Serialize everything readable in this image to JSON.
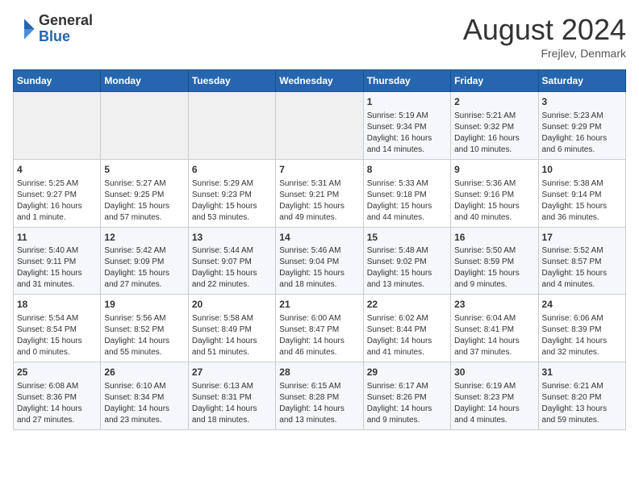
{
  "header": {
    "logo_general": "General",
    "logo_blue": "Blue",
    "month_title": "August 2024",
    "location": "Frejlev, Denmark"
  },
  "weekdays": [
    "Sunday",
    "Monday",
    "Tuesday",
    "Wednesday",
    "Thursday",
    "Friday",
    "Saturday"
  ],
  "weeks": [
    [
      {
        "day": "",
        "empty": true
      },
      {
        "day": "",
        "empty": true
      },
      {
        "day": "",
        "empty": true
      },
      {
        "day": "",
        "empty": true
      },
      {
        "day": "1",
        "line1": "Sunrise: 5:19 AM",
        "line2": "Sunset: 9:34 PM",
        "line3": "Daylight: 16 hours",
        "line4": "and 14 minutes."
      },
      {
        "day": "2",
        "line1": "Sunrise: 5:21 AM",
        "line2": "Sunset: 9:32 PM",
        "line3": "Daylight: 16 hours",
        "line4": "and 10 minutes."
      },
      {
        "day": "3",
        "line1": "Sunrise: 5:23 AM",
        "line2": "Sunset: 9:29 PM",
        "line3": "Daylight: 16 hours",
        "line4": "and 6 minutes."
      }
    ],
    [
      {
        "day": "4",
        "line1": "Sunrise: 5:25 AM",
        "line2": "Sunset: 9:27 PM",
        "line3": "Daylight: 16 hours",
        "line4": "and 1 minute."
      },
      {
        "day": "5",
        "line1": "Sunrise: 5:27 AM",
        "line2": "Sunset: 9:25 PM",
        "line3": "Daylight: 15 hours",
        "line4": "and 57 minutes."
      },
      {
        "day": "6",
        "line1": "Sunrise: 5:29 AM",
        "line2": "Sunset: 9:23 PM",
        "line3": "Daylight: 15 hours",
        "line4": "and 53 minutes."
      },
      {
        "day": "7",
        "line1": "Sunrise: 5:31 AM",
        "line2": "Sunset: 9:21 PM",
        "line3": "Daylight: 15 hours",
        "line4": "and 49 minutes."
      },
      {
        "day": "8",
        "line1": "Sunrise: 5:33 AM",
        "line2": "Sunset: 9:18 PM",
        "line3": "Daylight: 15 hours",
        "line4": "and 44 minutes."
      },
      {
        "day": "9",
        "line1": "Sunrise: 5:36 AM",
        "line2": "Sunset: 9:16 PM",
        "line3": "Daylight: 15 hours",
        "line4": "and 40 minutes."
      },
      {
        "day": "10",
        "line1": "Sunrise: 5:38 AM",
        "line2": "Sunset: 9:14 PM",
        "line3": "Daylight: 15 hours",
        "line4": "and 36 minutes."
      }
    ],
    [
      {
        "day": "11",
        "line1": "Sunrise: 5:40 AM",
        "line2": "Sunset: 9:11 PM",
        "line3": "Daylight: 15 hours",
        "line4": "and 31 minutes."
      },
      {
        "day": "12",
        "line1": "Sunrise: 5:42 AM",
        "line2": "Sunset: 9:09 PM",
        "line3": "Daylight: 15 hours",
        "line4": "and 27 minutes."
      },
      {
        "day": "13",
        "line1": "Sunrise: 5:44 AM",
        "line2": "Sunset: 9:07 PM",
        "line3": "Daylight: 15 hours",
        "line4": "and 22 minutes."
      },
      {
        "day": "14",
        "line1": "Sunrise: 5:46 AM",
        "line2": "Sunset: 9:04 PM",
        "line3": "Daylight: 15 hours",
        "line4": "and 18 minutes."
      },
      {
        "day": "15",
        "line1": "Sunrise: 5:48 AM",
        "line2": "Sunset: 9:02 PM",
        "line3": "Daylight: 15 hours",
        "line4": "and 13 minutes."
      },
      {
        "day": "16",
        "line1": "Sunrise: 5:50 AM",
        "line2": "Sunset: 8:59 PM",
        "line3": "Daylight: 15 hours",
        "line4": "and 9 minutes."
      },
      {
        "day": "17",
        "line1": "Sunrise: 5:52 AM",
        "line2": "Sunset: 8:57 PM",
        "line3": "Daylight: 15 hours",
        "line4": "and 4 minutes."
      }
    ],
    [
      {
        "day": "18",
        "line1": "Sunrise: 5:54 AM",
        "line2": "Sunset: 8:54 PM",
        "line3": "Daylight: 15 hours",
        "line4": "and 0 minutes."
      },
      {
        "day": "19",
        "line1": "Sunrise: 5:56 AM",
        "line2": "Sunset: 8:52 PM",
        "line3": "Daylight: 14 hours",
        "line4": "and 55 minutes."
      },
      {
        "day": "20",
        "line1": "Sunrise: 5:58 AM",
        "line2": "Sunset: 8:49 PM",
        "line3": "Daylight: 14 hours",
        "line4": "and 51 minutes."
      },
      {
        "day": "21",
        "line1": "Sunrise: 6:00 AM",
        "line2": "Sunset: 8:47 PM",
        "line3": "Daylight: 14 hours",
        "line4": "and 46 minutes."
      },
      {
        "day": "22",
        "line1": "Sunrise: 6:02 AM",
        "line2": "Sunset: 8:44 PM",
        "line3": "Daylight: 14 hours",
        "line4": "and 41 minutes."
      },
      {
        "day": "23",
        "line1": "Sunrise: 6:04 AM",
        "line2": "Sunset: 8:41 PM",
        "line3": "Daylight: 14 hours",
        "line4": "and 37 minutes."
      },
      {
        "day": "24",
        "line1": "Sunrise: 6:06 AM",
        "line2": "Sunset: 8:39 PM",
        "line3": "Daylight: 14 hours",
        "line4": "and 32 minutes."
      }
    ],
    [
      {
        "day": "25",
        "line1": "Sunrise: 6:08 AM",
        "line2": "Sunset: 8:36 PM",
        "line3": "Daylight: 14 hours",
        "line4": "and 27 minutes."
      },
      {
        "day": "26",
        "line1": "Sunrise: 6:10 AM",
        "line2": "Sunset: 8:34 PM",
        "line3": "Daylight: 14 hours",
        "line4": "and 23 minutes."
      },
      {
        "day": "27",
        "line1": "Sunrise: 6:13 AM",
        "line2": "Sunset: 8:31 PM",
        "line3": "Daylight: 14 hours",
        "line4": "and 18 minutes."
      },
      {
        "day": "28",
        "line1": "Sunrise: 6:15 AM",
        "line2": "Sunset: 8:28 PM",
        "line3": "Daylight: 14 hours",
        "line4": "and 13 minutes."
      },
      {
        "day": "29",
        "line1": "Sunrise: 6:17 AM",
        "line2": "Sunset: 8:26 PM",
        "line3": "Daylight: 14 hours",
        "line4": "and 9 minutes."
      },
      {
        "day": "30",
        "line1": "Sunrise: 6:19 AM",
        "line2": "Sunset: 8:23 PM",
        "line3": "Daylight: 14 hours",
        "line4": "and 4 minutes."
      },
      {
        "day": "31",
        "line1": "Sunrise: 6:21 AM",
        "line2": "Sunset: 8:20 PM",
        "line3": "Daylight: 13 hours",
        "line4": "and 59 minutes."
      }
    ]
  ]
}
